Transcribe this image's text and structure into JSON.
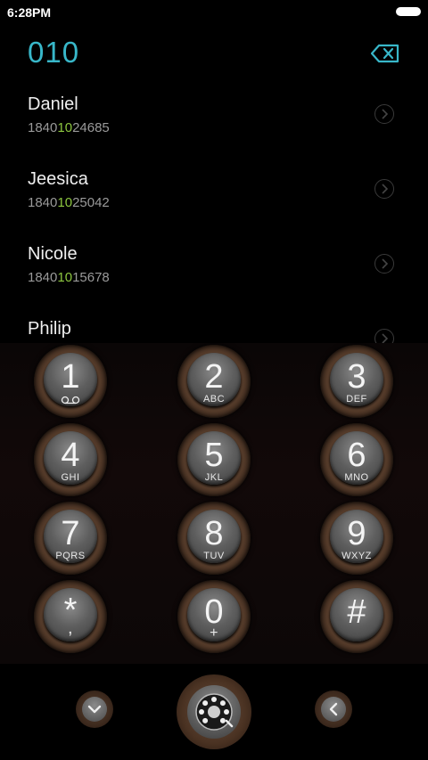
{
  "status": {
    "time": "6:28PM"
  },
  "dialer": {
    "number": "010"
  },
  "results": [
    {
      "name": "Daniel",
      "number_pre": "1840",
      "number_match": "10",
      "number_post": "24685"
    },
    {
      "name": "Jeesica",
      "number_pre": "1840",
      "number_match": "10",
      "number_post": "25042"
    },
    {
      "name": "Nicole",
      "number_pre": "1840",
      "number_match": "10",
      "number_post": "15678"
    },
    {
      "name": "Philip",
      "number_pre": "",
      "number_match": "",
      "number_post": ""
    }
  ],
  "keys": [
    {
      "digit": "1",
      "letters": ""
    },
    {
      "digit": "2",
      "letters": "ABC"
    },
    {
      "digit": "3",
      "letters": "DEF"
    },
    {
      "digit": "4",
      "letters": "GHI"
    },
    {
      "digit": "5",
      "letters": "JKL"
    },
    {
      "digit": "6",
      "letters": "MNO"
    },
    {
      "digit": "7",
      "letters": "PQRS"
    },
    {
      "digit": "8",
      "letters": "TUV"
    },
    {
      "digit": "9",
      "letters": "WXYZ"
    },
    {
      "digit": "*",
      "letters": ","
    },
    {
      "digit": "0",
      "letters": "+"
    },
    {
      "digit": "#",
      "letters": ""
    }
  ],
  "colors": {
    "accent": "#38b7c9",
    "match": "#8cc63f"
  },
  "icons": {
    "backspace": "backspace-icon",
    "voicemail": "voicemail-icon",
    "collapse": "chevron-down-icon",
    "call": "rotary-phone-icon",
    "back": "chevron-left-icon"
  }
}
